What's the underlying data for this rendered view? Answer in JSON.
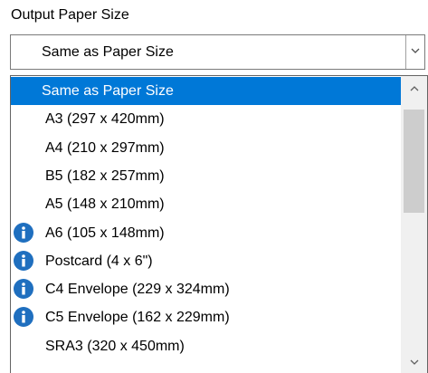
{
  "label": "Output Paper Size",
  "combo": {
    "selected": "Same as Paper Size"
  },
  "dropdown": {
    "items": [
      {
        "label": "Same as Paper Size",
        "selected": true,
        "info_icon": false
      },
      {
        "label": "A3 (297 x 420mm)",
        "selected": false,
        "info_icon": false
      },
      {
        "label": "A4 (210 x 297mm)",
        "selected": false,
        "info_icon": false
      },
      {
        "label": "B5 (182 x 257mm)",
        "selected": false,
        "info_icon": false
      },
      {
        "label": "A5 (148 x 210mm)",
        "selected": false,
        "info_icon": false
      },
      {
        "label": "A6 (105 x 148mm)",
        "selected": false,
        "info_icon": true
      },
      {
        "label": "Postcard (4 x 6\")",
        "selected": false,
        "info_icon": true
      },
      {
        "label": "C4 Envelope (229 x 324mm)",
        "selected": false,
        "info_icon": true
      },
      {
        "label": "C5 Envelope (162 x 229mm)",
        "selected": false,
        "info_icon": true
      },
      {
        "label": "SRA3 (320 x 450mm)",
        "selected": false,
        "info_icon": false
      }
    ]
  },
  "colors": {
    "selection": "#0078d7",
    "info_icon": "#1f6fbf",
    "scroll_track": "#f0f0f0",
    "scroll_thumb": "#cdcdcd"
  },
  "icons": {
    "info": "info-icon",
    "combo_arrow": "chevron-down-icon",
    "scroll_up": "chevron-up-icon",
    "scroll_down": "chevron-down-icon"
  }
}
